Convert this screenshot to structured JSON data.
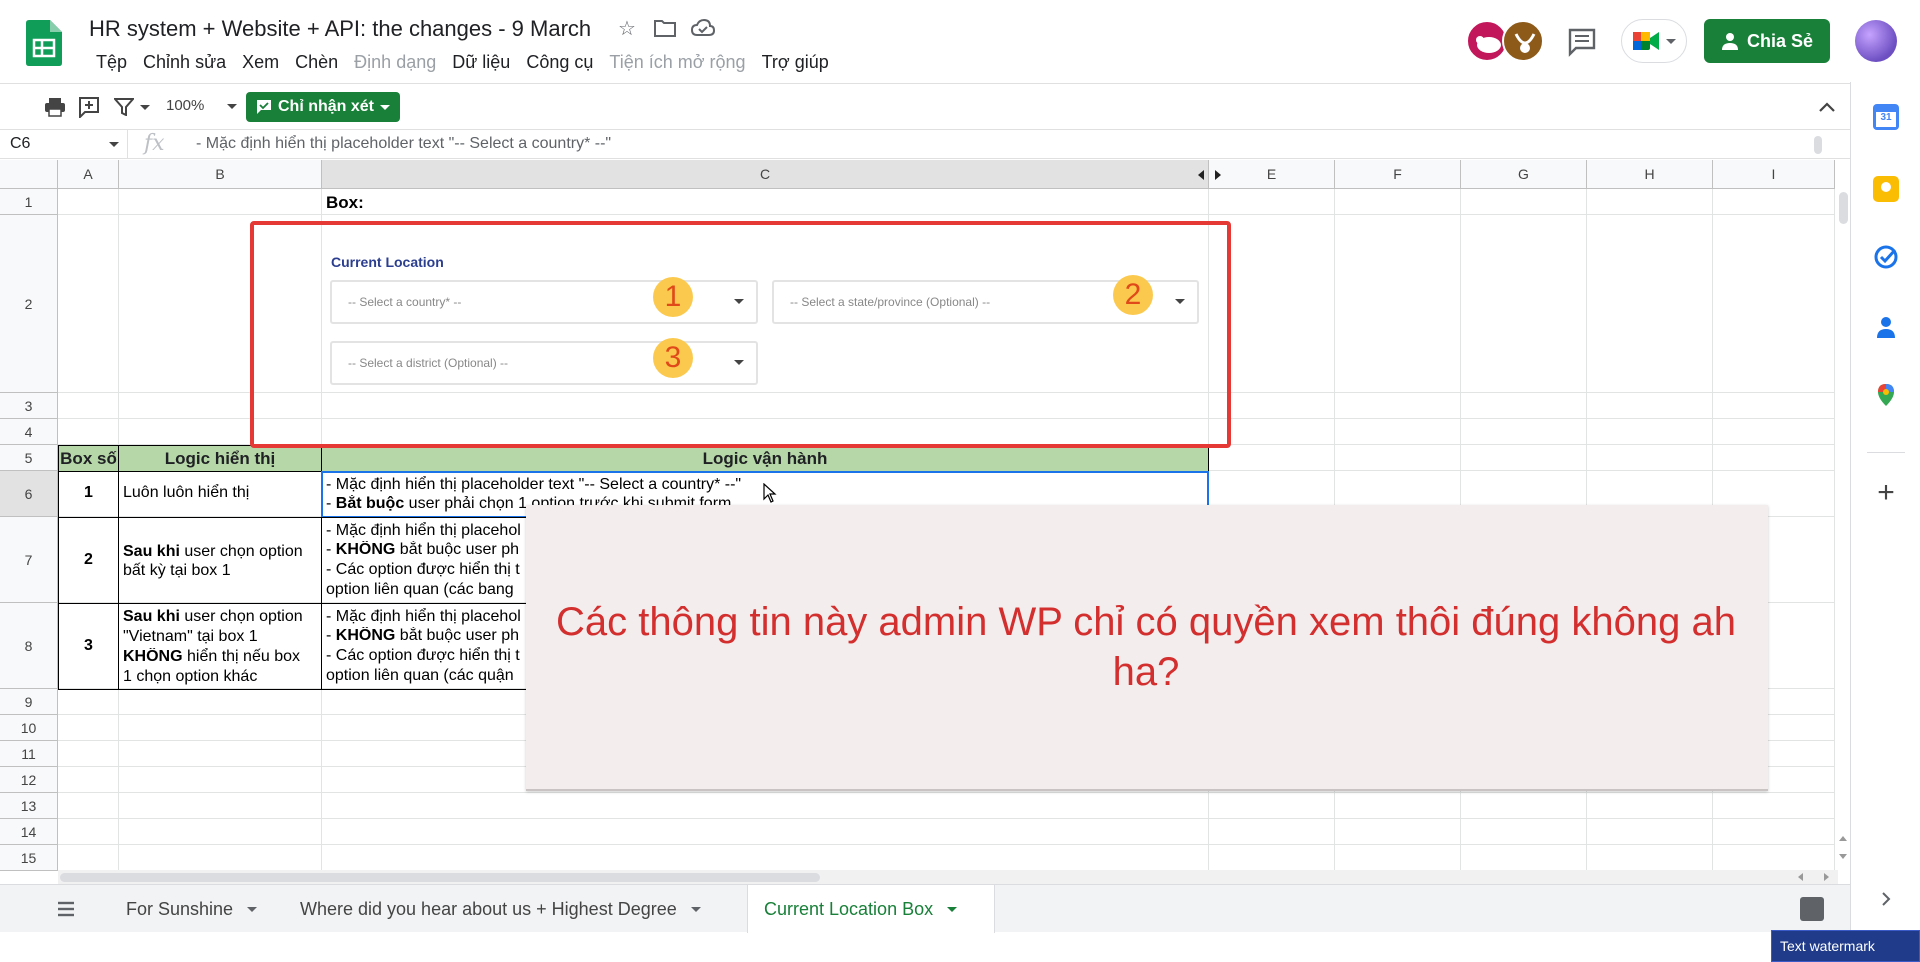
{
  "header": {
    "doc_title": "HR system + Website + API: the changes - 9 March",
    "menu": [
      "Tệp",
      "Chỉnh sửa",
      "Xem",
      "Chèn",
      "Định dạng",
      "Dữ liệu",
      "Công cụ",
      "Tiện ích mở rộng",
      "Trợ giúp"
    ],
    "share_label": "Chia Sẻ"
  },
  "toolbar": {
    "zoom": "100%",
    "mode_label": "Chỉ nhận xét"
  },
  "formula_bar": {
    "cell_ref": "C6",
    "fx": "fx",
    "content": "- Mặc định hiển thị placeholder text \"-- Select a country* --\""
  },
  "grid": {
    "columns": [
      "A",
      "B",
      "C",
      "D",
      "E",
      "F",
      "G",
      "H",
      "I"
    ],
    "rows": [
      "1",
      "2",
      "3",
      "4",
      "5",
      "6",
      "7",
      "8",
      "9",
      "10",
      "11",
      "12",
      "13",
      "14",
      "15"
    ],
    "c1": "Box:",
    "table": {
      "headers": [
        "Box số",
        "Logic hiển thị",
        "Logic vận hành"
      ],
      "rows": [
        {
          "num": "1",
          "display_plain": "Luôn luôn hiển thị",
          "op_line1": "- Mặc định hiển thị placeholder text \"-- Select a country* --\"",
          "op_line2_bold": "Bắt buộc",
          "op_line2_rest": " user phải chọn 1 option trước khi submit form",
          "op_line2_prefix": "- "
        },
        {
          "num": "2",
          "display_bold": "Sau khi",
          "display_rest1": " user chọn option",
          "display_line2": "bất kỳ tại box 1",
          "op_line1": "- Mặc định hiển thị placehol",
          "op_line2_prefix": "- ",
          "op_line2_bold": "KHÔNG",
          "op_line2_rest": " bắt buộc user ph",
          "op_line3": "- Các option được hiển thị t",
          "op_line4": "option liên quan (các bang"
        },
        {
          "num": "3",
          "display_bold": "Sau khi",
          "display_rest1": " user chọn option",
          "display_line2": "\"Vietnam\" tại box 1",
          "display_line3_bold": "KHÔNG",
          "display_line3_rest": " hiển thị nếu box",
          "display_line4": "1 chọn option khác",
          "op_line1": "- Mặc định hiển thị placehol",
          "op_line2_prefix": "- ",
          "op_line2_bold": "KHÔNG",
          "op_line2_rest": " bắt buộc user ph",
          "op_line3": "- Các option được hiển thị t",
          "op_line4": "option liên quan (các quận"
        }
      ]
    }
  },
  "embedded_image": {
    "label": "Current Location",
    "dropdowns": [
      {
        "placeholder": "-- Select a country* --",
        "badge": "1"
      },
      {
        "placeholder": "-- Select a state/province (Optional) --",
        "badge": "2"
      },
      {
        "placeholder": "-- Select a district (Optional) --",
        "badge": "3"
      }
    ]
  },
  "comment_overlay": {
    "text": "Các thông tin này admin WP chỉ có quyền xem thôi đúng không ah ha?"
  },
  "tabs": [
    {
      "label": "For Sunshine",
      "active": false
    },
    {
      "label": "Where did you hear about us + Highest Degree",
      "active": false
    },
    {
      "label": "Current Location Box",
      "active": true
    }
  ],
  "watermark": "Text watermark",
  "colors": {
    "brand_green": "#188038",
    "header_green": "#b6d7a8",
    "frame_red": "#e53935",
    "overlay_text_red": "#d32f2f"
  }
}
